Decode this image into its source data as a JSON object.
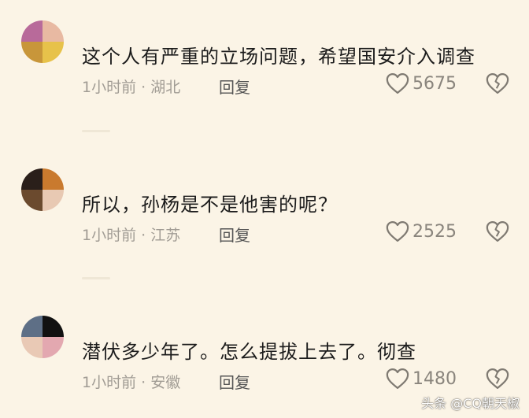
{
  "comments": [
    {
      "text": "这个人有严重的立场问题，希望国安介入调查",
      "meta": "1小时前 · 湖北",
      "reply_label": "回复",
      "likes": "5675",
      "avatar_colors": [
        "#b86a9a",
        "#e8b9a2",
        "#c8963a",
        "#e7c24a"
      ]
    },
    {
      "text": "所以，孙杨是不是他害的呢？",
      "meta": "1小时前 · 江苏",
      "reply_label": "回复",
      "likes": "2525",
      "avatar_colors": [
        "#2a1f1a",
        "#c97a2e",
        "#6b4a2e",
        "#e8c9b3"
      ]
    },
    {
      "text": "潜伏多少年了。怎么提拔上去了。彻查",
      "meta": "1小时前 · 安徽",
      "reply_label": "回复",
      "likes": "1480",
      "avatar_colors": [
        "#5e6f86",
        "#111111",
        "#e9c9b5",
        "#e3a8b0"
      ]
    }
  ],
  "icons": {
    "like": "heart-outline-icon",
    "dislike": "broken-heart-icon"
  },
  "watermark": "头条 @CQ朝天椒"
}
